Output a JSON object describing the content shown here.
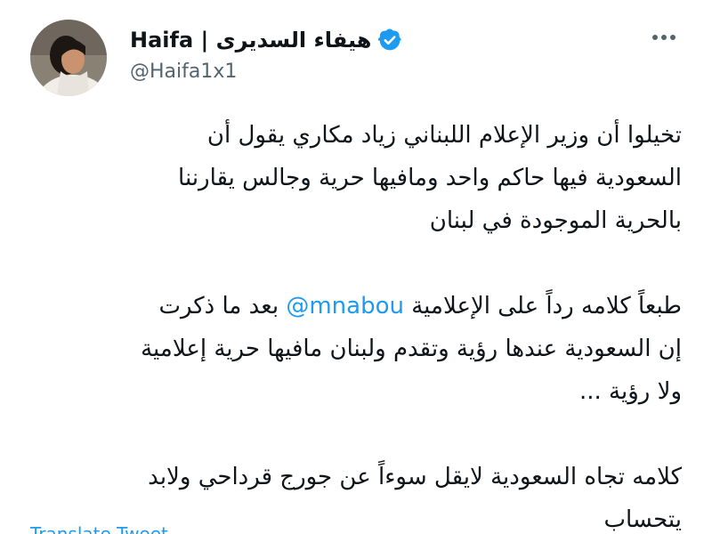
{
  "user": {
    "display_name": "Haifa | هيفاء السديرى",
    "handle": "@Haifa1x1",
    "verified": true
  },
  "tweet": {
    "p1_l1": "تخيلوا أن وزير الإعلام اللبناني زياد مكاري يقول أن",
    "p1_l2": "السعودية فيها حاكم واحد ومافيها حرية وجالس يقارننا",
    "p1_l3": "بالحرية الموجودة في لبنان",
    "p2_l1_pre": "طبعاً كلامه رداً على الإعلامية",
    "mention": "@mnabou",
    "p2_l1_post": "بعد ما ذكرت",
    "p2_l2": "إن السعودية عندها رؤية وتقدم ولبنان مافيها حرية إعلامية",
    "p2_l3": "ولا رؤية ...",
    "p3_l1": "كلامه تجاه السعودية لايقل سوءاً عن جورج قرداحي ولابد",
    "p3_l2": "يتحساب"
  },
  "translate_label": "Translate Tweet",
  "icons": {
    "verified": "verified-badge-icon",
    "more": "more-options-icon"
  },
  "colors": {
    "accent": "#1d9bf0",
    "text": "#0f1419",
    "secondary": "#536471"
  }
}
